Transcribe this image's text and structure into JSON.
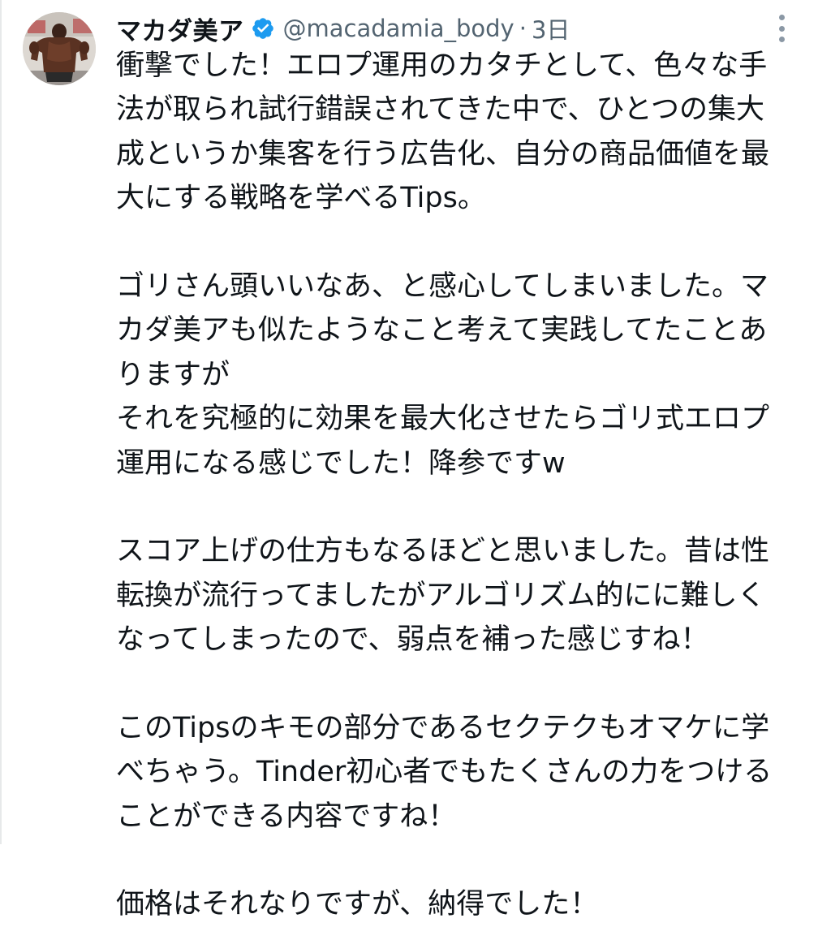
{
  "tweet": {
    "author_name": "マカダ美ア",
    "handle": "@macadamia_body",
    "separator": "·",
    "time": "3日",
    "avatar_icon": "bodybuilder-avatar",
    "verified_icon": "verified-badge-icon",
    "verified_color": "#1d9bf0",
    "more_icon": "more-options-icon",
    "text_color": "#0f1419",
    "meta_color": "#536471",
    "lines": [
      "衝撃でした！エロプ運用のカタチとして、色々な手",
      "法が取られ試行錯誤されてきた中で、ひとつの集大",
      "成というか集客を行う広告化、自分の商品価値を最",
      "大にする戦略を学べるTips。",
      "",
      "ゴリさん頭いいなあ、と感心してしまいました。マ",
      "カダ美アも似たようなこと考えて実践してたことあ",
      "りますが",
      "それを究極的に効果を最大化させたらゴリ式エロプ",
      "運用になる感じでした！降参ですw",
      "",
      "スコア上げの仕方もなるほどと思いました。昔は性",
      "転換が流行ってましたがアルゴリズム的にに難しく",
      "なってしまったので、弱点を補った感じすね！",
      "",
      "このTipsのキモの部分であるセクテクもオマケに学",
      "べちゃう。Tinder初心者でもたくさんの力をつける",
      "ことができる内容ですね！",
      "",
      "価格はそれなりですが、納得でした！"
    ]
  }
}
